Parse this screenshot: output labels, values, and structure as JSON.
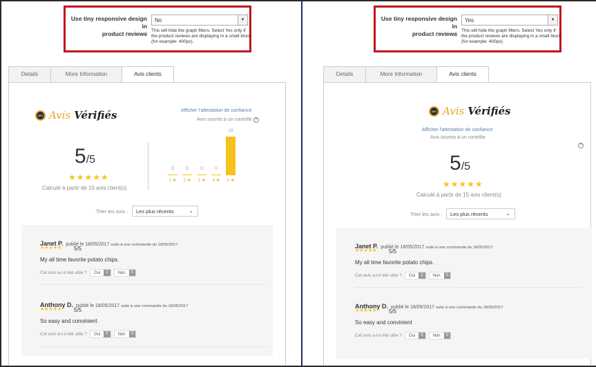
{
  "config": {
    "label_line1": "Use tiny responsive design in",
    "label_line2": "product reviews",
    "scope": "[store view]",
    "note": "This will hide the graph filters. Select Yes only if the product reviews are displaying in a small block (for example: 400px)."
  },
  "panels": [
    {
      "select_value": "No",
      "layout": "full"
    },
    {
      "select_value": "Yes",
      "layout": "tiny"
    }
  ],
  "tabs": [
    {
      "label": "Details"
    },
    {
      "label": "More Information"
    },
    {
      "label": "Avis clients",
      "active": true
    }
  ],
  "logo": {
    "text_avis": "Avis",
    "text_verifies": "Vérifiés",
    "badge": "avis"
  },
  "attestation_link": "Afficher l'attestation de confiance",
  "controle": "Avis soumis à un contrôle",
  "score": {
    "value": "5",
    "denominator": "/5",
    "stars": "★★★★★"
  },
  "calc": "Calculé à partir de 15 avis client(s)",
  "chart_data": {
    "type": "bar",
    "categories": [
      "1 ★",
      "2 ★",
      "3 ★",
      "4 ★",
      "5 ★"
    ],
    "values": [
      0,
      0,
      0,
      0,
      15
    ],
    "ylim": [
      0,
      15
    ]
  },
  "sort": {
    "label": "Trier les avis :",
    "value": "Les plus récents"
  },
  "reviews": [
    {
      "name": "Janet P.",
      "published": "publié le 18/05/2017",
      "order": "suite à une commande du 18/05/2017",
      "stars": "★★★★★",
      "rating": "5/5",
      "text": "My all time favorite potato chips.",
      "useful": "Cet avis a-t-il été utile ?",
      "yes_label": "Oui",
      "yes_count": "1",
      "no_label": "Non",
      "no_count": "0"
    },
    {
      "name": "Anthony D.",
      "published": "publié le 18/05/2017",
      "order": "suite à une commande du 18/05/2017",
      "stars": "★★★★★",
      "rating": "5/5",
      "text": "So easy and convinient",
      "useful": "Cet avis a-t-il été utile ?",
      "yes_label": "Oui",
      "yes_count": "0",
      "no_label": "Non",
      "no_count": "0"
    }
  ],
  "icons": {
    "select_arrow": "triangle-down",
    "sort_chevron": "chevron-down",
    "help": "question-circle"
  },
  "colors": {
    "highlight_border": "#c0121b",
    "star": "#f5c31b",
    "link": "#5a7bb0"
  }
}
